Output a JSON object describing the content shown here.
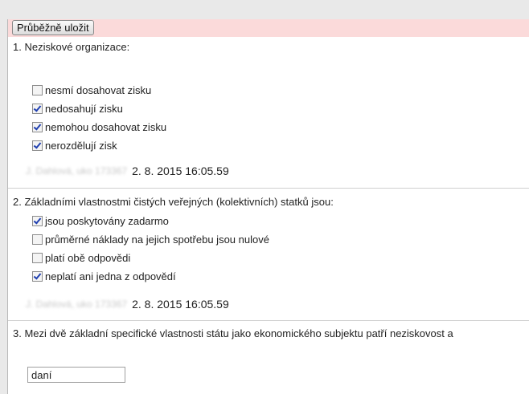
{
  "toolbar": {
    "save_label": "Průběžně uložit"
  },
  "questions": [
    {
      "title": "1. Neziskové organizace:",
      "options": [
        {
          "label": "nesmí dosahovat zisku",
          "checked": false
        },
        {
          "label": "nedosahují zisku",
          "checked": true
        },
        {
          "label": "nemohou dosahovat zisku",
          "checked": true
        },
        {
          "label": "nerozdělují zisk",
          "checked": true
        }
      ],
      "author": "J. Dahlová, uko 173367",
      "date": "2. 8. 2015 16:05.59"
    },
    {
      "title": "2. Základními vlastnostmi čistých veřejných (kolektivních) statků jsou:",
      "options": [
        {
          "label": "jsou poskytovány zadarmo",
          "checked": true
        },
        {
          "label": "průměrné náklady na jejich spotřebu jsou nulové",
          "checked": false
        },
        {
          "label": "platí obě odpovědi",
          "checked": false
        },
        {
          "label": "neplatí ani jedna z odpovědí",
          "checked": true
        }
      ],
      "author": "J. Dahlová, uko 173367",
      "date": "2. 8. 2015 16:05.59"
    },
    {
      "title": "3. Mezi dvě základní specifické vlastnosti státu jako ekonomického subjektu patří neziskovost a",
      "answer": "daní"
    }
  ]
}
